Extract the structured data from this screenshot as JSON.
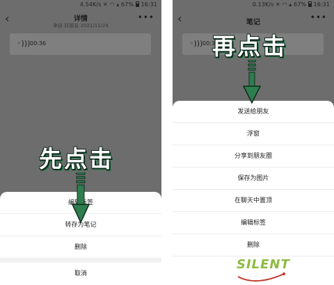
{
  "left_phone": {
    "status": {
      "speed": "4.54K/s",
      "battery": "67%",
      "time": "16:31"
    },
    "header": {
      "title": "详情",
      "subtitle": "来自 好朋友 2021/11/24"
    },
    "voice": {
      "duration": "00:36"
    },
    "sheet": {
      "items": [
        "编辑标签",
        "转存为笔记",
        "删除"
      ],
      "cancel": "取消"
    },
    "overlay": "先点击"
  },
  "right_phone": {
    "status": {
      "speed": "0.13K/s",
      "battery": "67%",
      "time": "16:31"
    },
    "header": {
      "title": "笔记"
    },
    "voice": {
      "duration": "00:3"
    },
    "sheet": {
      "items": [
        "发送给朋友",
        "浮窗",
        "分享到朋友圈",
        "保存为图片",
        "在聊天中置顶",
        "编辑标签",
        "删除"
      ]
    },
    "overlay": "再点击"
  },
  "watermark": {
    "word": "SILENT"
  },
  "colors": {
    "arrow_fill": "#2e7d4f",
    "arrow_outline": "#0f2a1c",
    "overlay_backdrop": "#6d6d6d",
    "watermark_green": "#8cbc3f",
    "watermark_swoosh": "#c0392b"
  }
}
